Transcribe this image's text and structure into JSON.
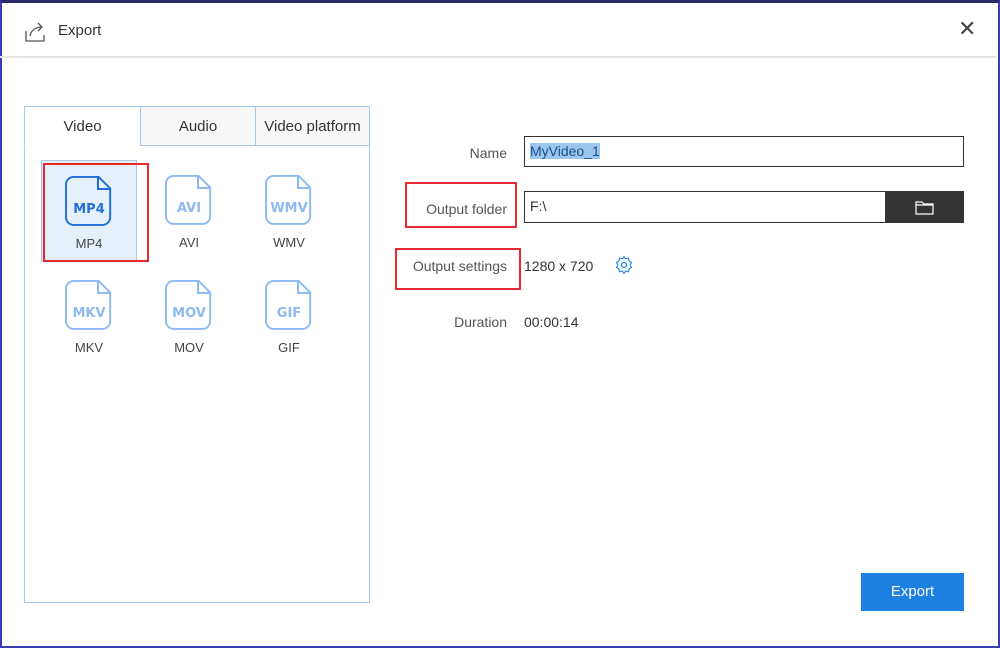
{
  "window": {
    "title": "Export"
  },
  "tabs": [
    {
      "label": "Video"
    },
    {
      "label": "Audio"
    },
    {
      "label": "Video platform"
    }
  ],
  "formats": [
    {
      "icon_text": "MP4",
      "label": "MP4"
    },
    {
      "icon_text": "AVI",
      "label": "AVI"
    },
    {
      "icon_text": "WMV",
      "label": "WMV"
    },
    {
      "icon_text": "MKV",
      "label": "MKV"
    },
    {
      "icon_text": "MOV",
      "label": "MOV"
    },
    {
      "icon_text": "GIF",
      "label": "GIF"
    }
  ],
  "form": {
    "name_label": "Name",
    "name_value": "MyVideo_1",
    "folder_label": "Output folder",
    "folder_value": "F:\\",
    "settings_label": "Output settings",
    "settings_value": "1280 x 720",
    "duration_label": "Duration",
    "duration_value": "00:00:14"
  },
  "export_button": "Export",
  "colors": {
    "accent": "#1e7fe3",
    "highlight": "#e8292f"
  }
}
